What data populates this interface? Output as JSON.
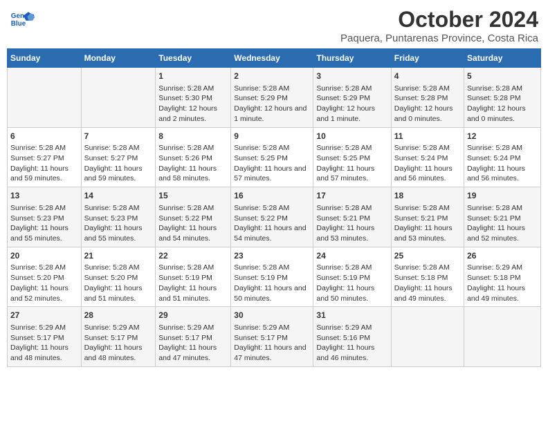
{
  "header": {
    "logo_general": "General",
    "logo_blue": "Blue",
    "title": "October 2024",
    "subtitle": "Paquera, Puntarenas Province, Costa Rica"
  },
  "columns": [
    "Sunday",
    "Monday",
    "Tuesday",
    "Wednesday",
    "Thursday",
    "Friday",
    "Saturday"
  ],
  "weeks": [
    [
      {
        "day": "",
        "info": ""
      },
      {
        "day": "",
        "info": ""
      },
      {
        "day": "1",
        "info": "Sunrise: 5:28 AM\nSunset: 5:30 PM\nDaylight: 12 hours and 2 minutes."
      },
      {
        "day": "2",
        "info": "Sunrise: 5:28 AM\nSunset: 5:29 PM\nDaylight: 12 hours and 1 minute."
      },
      {
        "day": "3",
        "info": "Sunrise: 5:28 AM\nSunset: 5:29 PM\nDaylight: 12 hours and 1 minute."
      },
      {
        "day": "4",
        "info": "Sunrise: 5:28 AM\nSunset: 5:28 PM\nDaylight: 12 hours and 0 minutes."
      },
      {
        "day": "5",
        "info": "Sunrise: 5:28 AM\nSunset: 5:28 PM\nDaylight: 12 hours and 0 minutes."
      }
    ],
    [
      {
        "day": "6",
        "info": "Sunrise: 5:28 AM\nSunset: 5:27 PM\nDaylight: 11 hours and 59 minutes."
      },
      {
        "day": "7",
        "info": "Sunrise: 5:28 AM\nSunset: 5:27 PM\nDaylight: 11 hours and 59 minutes."
      },
      {
        "day": "8",
        "info": "Sunrise: 5:28 AM\nSunset: 5:26 PM\nDaylight: 11 hours and 58 minutes."
      },
      {
        "day": "9",
        "info": "Sunrise: 5:28 AM\nSunset: 5:25 PM\nDaylight: 11 hours and 57 minutes."
      },
      {
        "day": "10",
        "info": "Sunrise: 5:28 AM\nSunset: 5:25 PM\nDaylight: 11 hours and 57 minutes."
      },
      {
        "day": "11",
        "info": "Sunrise: 5:28 AM\nSunset: 5:24 PM\nDaylight: 11 hours and 56 minutes."
      },
      {
        "day": "12",
        "info": "Sunrise: 5:28 AM\nSunset: 5:24 PM\nDaylight: 11 hours and 56 minutes."
      }
    ],
    [
      {
        "day": "13",
        "info": "Sunrise: 5:28 AM\nSunset: 5:23 PM\nDaylight: 11 hours and 55 minutes."
      },
      {
        "day": "14",
        "info": "Sunrise: 5:28 AM\nSunset: 5:23 PM\nDaylight: 11 hours and 55 minutes."
      },
      {
        "day": "15",
        "info": "Sunrise: 5:28 AM\nSunset: 5:22 PM\nDaylight: 11 hours and 54 minutes."
      },
      {
        "day": "16",
        "info": "Sunrise: 5:28 AM\nSunset: 5:22 PM\nDaylight: 11 hours and 54 minutes."
      },
      {
        "day": "17",
        "info": "Sunrise: 5:28 AM\nSunset: 5:21 PM\nDaylight: 11 hours and 53 minutes."
      },
      {
        "day": "18",
        "info": "Sunrise: 5:28 AM\nSunset: 5:21 PM\nDaylight: 11 hours and 53 minutes."
      },
      {
        "day": "19",
        "info": "Sunrise: 5:28 AM\nSunset: 5:21 PM\nDaylight: 11 hours and 52 minutes."
      }
    ],
    [
      {
        "day": "20",
        "info": "Sunrise: 5:28 AM\nSunset: 5:20 PM\nDaylight: 11 hours and 52 minutes."
      },
      {
        "day": "21",
        "info": "Sunrise: 5:28 AM\nSunset: 5:20 PM\nDaylight: 11 hours and 51 minutes."
      },
      {
        "day": "22",
        "info": "Sunrise: 5:28 AM\nSunset: 5:19 PM\nDaylight: 11 hours and 51 minutes."
      },
      {
        "day": "23",
        "info": "Sunrise: 5:28 AM\nSunset: 5:19 PM\nDaylight: 11 hours and 50 minutes."
      },
      {
        "day": "24",
        "info": "Sunrise: 5:28 AM\nSunset: 5:19 PM\nDaylight: 11 hours and 50 minutes."
      },
      {
        "day": "25",
        "info": "Sunrise: 5:28 AM\nSunset: 5:18 PM\nDaylight: 11 hours and 49 minutes."
      },
      {
        "day": "26",
        "info": "Sunrise: 5:29 AM\nSunset: 5:18 PM\nDaylight: 11 hours and 49 minutes."
      }
    ],
    [
      {
        "day": "27",
        "info": "Sunrise: 5:29 AM\nSunset: 5:17 PM\nDaylight: 11 hours and 48 minutes."
      },
      {
        "day": "28",
        "info": "Sunrise: 5:29 AM\nSunset: 5:17 PM\nDaylight: 11 hours and 48 minutes."
      },
      {
        "day": "29",
        "info": "Sunrise: 5:29 AM\nSunset: 5:17 PM\nDaylight: 11 hours and 47 minutes."
      },
      {
        "day": "30",
        "info": "Sunrise: 5:29 AM\nSunset: 5:17 PM\nDaylight: 11 hours and 47 minutes."
      },
      {
        "day": "31",
        "info": "Sunrise: 5:29 AM\nSunset: 5:16 PM\nDaylight: 11 hours and 46 minutes."
      },
      {
        "day": "",
        "info": ""
      },
      {
        "day": "",
        "info": ""
      }
    ]
  ]
}
